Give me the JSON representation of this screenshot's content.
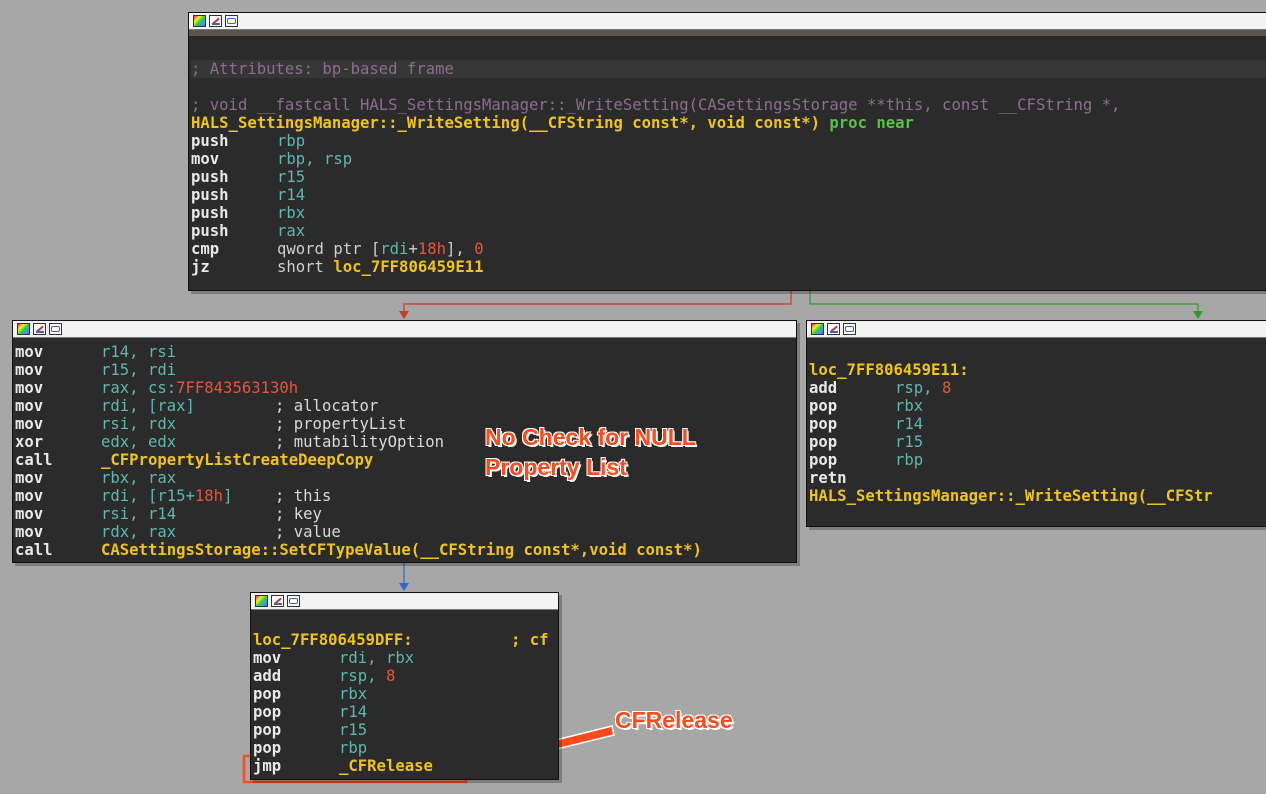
{
  "colors": {
    "background": "#a7a7a7",
    "node_bg": "#2b2b2b",
    "label": "#f0c418",
    "register": "#5eb8b0",
    "number": "#e8543c",
    "comment": "#8d6d8f",
    "edge_false": "#c83a2e",
    "edge_true": "#2f9a2f",
    "edge_flow": "#3366cc",
    "annotation": "#ff4a1c"
  },
  "node_toolbar": {
    "icons": [
      "graph-overview-icon",
      "edit-node-icon",
      "xrefs-icon"
    ]
  },
  "top_node": {
    "attributes_comment": "; Attributes: bp-based frame",
    "signature_comment": "; void __fastcall HALS_SettingsManager::_WriteSetting(CASettingsStorage **this, const __CFString *,",
    "proc_name": "HALS_SettingsManager::_WriteSetting(__CFString const*, void const*)",
    "proc_kw": " proc near",
    "lines": [
      {
        "m": "push",
        "a": "rbp"
      },
      {
        "m": "mov",
        "a": "rbp, rsp"
      },
      {
        "m": "push",
        "a": "r15"
      },
      {
        "m": "push",
        "a": "r14"
      },
      {
        "m": "push",
        "a": "rbx"
      },
      {
        "m": "push",
        "a": "rax"
      },
      {
        "m": "cmp",
        "a1": "qword ptr [",
        "a2": "rdi",
        "a3": "+",
        "a4": "18h",
        "a5": "], ",
        "a6": "0"
      },
      {
        "m": "jz",
        "a1": "short ",
        "a2": "loc_7FF806459E11"
      }
    ]
  },
  "left_node": {
    "lines": [
      {
        "m": "mov",
        "a": "r14, rsi"
      },
      {
        "m": "mov",
        "a": "r15, rdi"
      },
      {
        "m": "mov",
        "a1": "rax, cs:",
        "a2": "7FF843563130h"
      },
      {
        "m": "mov",
        "a": "rdi, [rax]",
        "c": "; allocator"
      },
      {
        "m": "mov",
        "a": "rsi, rdx",
        "c": "; propertyList"
      },
      {
        "m": "xor",
        "a": "edx, edx",
        "c": "; mutabilityOption"
      },
      {
        "m": "call",
        "s": "_CFPropertyListCreateDeepCopy"
      },
      {
        "m": "mov",
        "a": "rbx, rax"
      },
      {
        "m": "mov",
        "a1": "rdi, [r15+",
        "a2": "18h",
        "a3": "]",
        "c": "; this"
      },
      {
        "m": "mov",
        "a": "rsi, r14",
        "c": "; key"
      },
      {
        "m": "mov",
        "a": "rdx, rax",
        "c": "; value"
      },
      {
        "m": "call",
        "s": "CASettingsStorage::SetCFTypeValue(__CFString const*,void const*)"
      }
    ]
  },
  "right_node": {
    "label": "loc_7FF806459E11:",
    "lines": [
      {
        "m": "add",
        "a": "rsp, ",
        "n": "8"
      },
      {
        "m": "pop",
        "a": "rbx"
      },
      {
        "m": "pop",
        "a": "r14"
      },
      {
        "m": "pop",
        "a": "r15"
      },
      {
        "m": "pop",
        "a": "rbp"
      },
      {
        "m": "retn"
      }
    ],
    "tail": "HALS_SettingsManager::_WriteSetting(__CFStr"
  },
  "bottom_node": {
    "label": "loc_7FF806459DFF:",
    "label_comment": "; cf",
    "lines": [
      {
        "m": "mov",
        "a": "rdi, rbx"
      },
      {
        "m": "add",
        "a": "rsp, ",
        "n": "8"
      },
      {
        "m": "pop",
        "a": "rbx"
      },
      {
        "m": "pop",
        "a": "r14"
      },
      {
        "m": "pop",
        "a": "r15"
      },
      {
        "m": "pop",
        "a": "rbp"
      },
      {
        "m": "jmp",
        "s": "_CFRelease"
      }
    ]
  },
  "annotations": {
    "null_check_line1": "No Check for NULL",
    "null_check_line2": "Property List",
    "cfrelease": "CFRelease"
  }
}
